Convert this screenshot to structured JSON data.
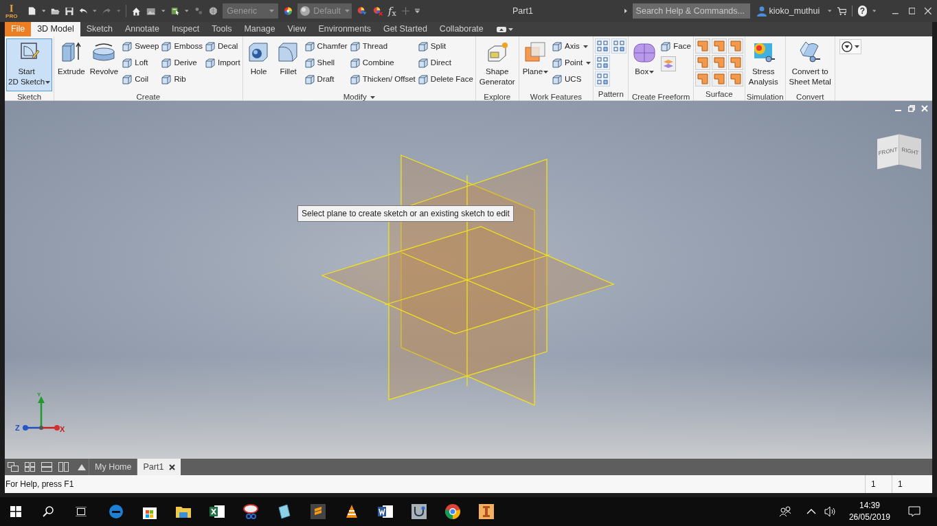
{
  "title_bar": {
    "logo": {
      "letter": "I",
      "badge": "PRO"
    },
    "material": "Generic",
    "appearance": "Default",
    "formula": "*f*$_{x}$",
    "title": "Part1",
    "search_placeholder": "Search Help & Commands...",
    "user": "kioko_muthui",
    "help": "?"
  },
  "menu_tabs": [
    {
      "label": "File",
      "kind": "file",
      "selected": false
    },
    {
      "label": "3D Model",
      "kind": "tab",
      "selected": true
    },
    {
      "label": "Sketch",
      "kind": "tab",
      "selected": false
    },
    {
      "label": "Annotate",
      "kind": "tab",
      "selected": false
    },
    {
      "label": "Inspect",
      "kind": "tab",
      "selected": false
    },
    {
      "label": "Tools",
      "kind": "tab",
      "selected": false
    },
    {
      "label": "Manage",
      "kind": "tab",
      "selected": false
    },
    {
      "label": "View",
      "kind": "tab",
      "selected": false
    },
    {
      "label": "Environments",
      "kind": "tab",
      "selected": false
    },
    {
      "label": "Get Started",
      "kind": "tab",
      "selected": false
    },
    {
      "label": "Collaborate",
      "kind": "tab",
      "selected": false
    }
  ],
  "ribbon_panels": [
    {
      "title": "Sketch",
      "menu": false,
      "columns": [
        {
          "kind": "large",
          "items": [
            {
              "label": "Start\n2D Sketch",
              "selected": true,
              "dropdown": true
            }
          ]
        }
      ]
    },
    {
      "title": "Create",
      "menu": false,
      "columns": [
        {
          "kind": "large",
          "items": [
            {
              "label": "Extrude",
              "selected": false,
              "dropdown": false
            }
          ]
        },
        {
          "kind": "large",
          "items": [
            {
              "label": "Revolve",
              "selected": false,
              "dropdown": false
            }
          ]
        },
        {
          "kind": "small",
          "items": [
            {
              "label": "Sweep",
              "dropdown": false
            },
            {
              "label": "Loft",
              "dropdown": false
            },
            {
              "label": "Coil",
              "dropdown": false
            }
          ]
        },
        {
          "kind": "small",
          "items": [
            {
              "label": "Emboss",
              "dropdown": false
            },
            {
              "label": "Derive",
              "dropdown": false
            },
            {
              "label": "Rib",
              "dropdown": false
            }
          ]
        },
        {
          "kind": "small",
          "items": [
            {
              "label": "Decal",
              "dropdown": false
            },
            {
              "label": "Import",
              "dropdown": false
            }
          ]
        }
      ]
    },
    {
      "title": "Modify",
      "menu": true,
      "columns": [
        {
          "kind": "large",
          "items": [
            {
              "label": "Hole",
              "selected": false,
              "dropdown": false
            }
          ]
        },
        {
          "kind": "large",
          "items": [
            {
              "label": "Fillet",
              "selected": false,
              "dropdown": false
            }
          ]
        },
        {
          "kind": "small",
          "items": [
            {
              "label": "Chamfer",
              "dropdown": false
            },
            {
              "label": "Shell",
              "dropdown": false
            },
            {
              "label": "Draft",
              "dropdown": false
            }
          ]
        },
        {
          "kind": "small",
          "items": [
            {
              "label": "Thread",
              "dropdown": false
            },
            {
              "label": "Combine",
              "dropdown": false
            },
            {
              "label": "Thicken/ Offset",
              "dropdown": false
            }
          ]
        },
        {
          "kind": "small",
          "items": [
            {
              "label": "Split",
              "dropdown": false
            },
            {
              "label": "Direct",
              "dropdown": false
            },
            {
              "label": "Delete Face",
              "dropdown": false
            }
          ]
        }
      ]
    },
    {
      "title": "Explore",
      "menu": false,
      "columns": [
        {
          "kind": "large",
          "items": [
            {
              "label": "Shape\nGenerator",
              "selected": false,
              "dropdown": false
            }
          ]
        }
      ]
    },
    {
      "title": "Work Features",
      "menu": false,
      "columns": [
        {
          "kind": "large",
          "items": [
            {
              "label": "Plane",
              "selected": false,
              "dropdown": true
            }
          ]
        },
        {
          "kind": "small",
          "items": [
            {
              "label": "Axis",
              "dropdown": true
            },
            {
              "label": "Point",
              "dropdown": true
            },
            {
              "label": "UCS",
              "dropdown": false
            }
          ]
        }
      ]
    },
    {
      "title": "Pattern",
      "menu": false,
      "columns": [
        {
          "kind": "pattern-grid"
        }
      ]
    },
    {
      "title": "Create Freeform",
      "menu": false,
      "columns": [
        {
          "kind": "large",
          "items": [
            {
              "label": "Box",
              "selected": false,
              "dropdown": true
            }
          ]
        },
        {
          "kind": "small",
          "items": [
            {
              "label": "Face",
              "dropdown": false
            }
          ]
        }
      ]
    },
    {
      "title": "Surface",
      "menu": false,
      "columns": [
        {
          "kind": "surface-grid"
        }
      ]
    },
    {
      "title": "Simulation",
      "menu": false,
      "columns": [
        {
          "kind": "large",
          "items": [
            {
              "label": "Stress\nAnalysis",
              "selected": false,
              "dropdown": false
            }
          ]
        }
      ]
    },
    {
      "title": "Convert",
      "menu": false,
      "columns": [
        {
          "kind": "large",
          "items": [
            {
              "label": "Convert to\nSheet Metal",
              "selected": false,
              "dropdown": false
            }
          ]
        }
      ]
    }
  ],
  "viewport": {
    "tooltip": "Select plane to create sketch or an existing sketch to edit",
    "viewcube": [
      "FRONT",
      "RIGHT"
    ],
    "axes": [
      "Y",
      "Z",
      "X"
    ]
  },
  "document_tabs": [
    {
      "label": "My Home",
      "selected": false,
      "closable": false
    },
    {
      "label": "Part1",
      "selected": true,
      "closable": true
    }
  ],
  "status_bar": {
    "help": "For Help, press F1",
    "fields": [
      "1",
      "1"
    ]
  },
  "taskbar": {
    "time": "14:39",
    "date": "26/05/2019"
  }
}
